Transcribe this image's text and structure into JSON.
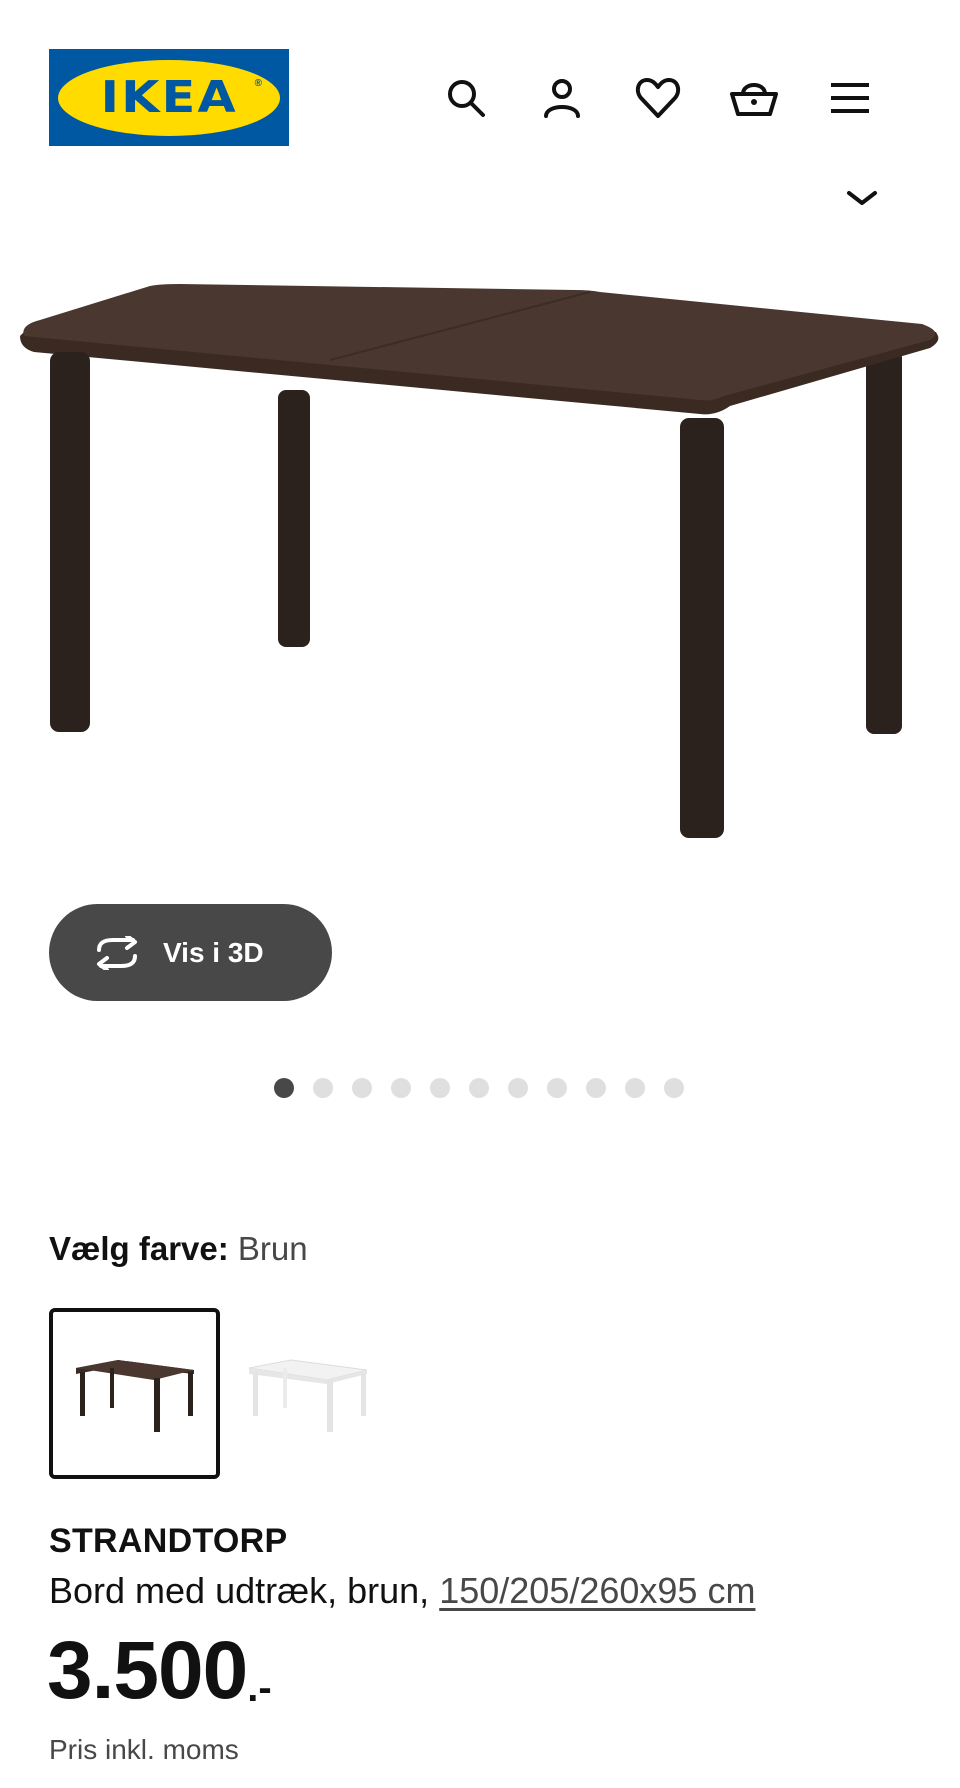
{
  "brand": {
    "logo_text": "IKEA",
    "logo_mark": "®",
    "colors": {
      "blue": "#0058a3",
      "yellow": "#ffdb00"
    }
  },
  "header": {
    "icons": [
      "search-icon",
      "user-icon",
      "heart-icon",
      "basket-icon",
      "menu-icon"
    ]
  },
  "gallery": {
    "view_3d_label": "Vis i 3D",
    "dot_count": 11,
    "active_dot": 1
  },
  "color": {
    "label": "Vælg farve:",
    "value": "Brun",
    "options": [
      "brown",
      "white"
    ],
    "selected": "brown"
  },
  "product": {
    "name": "STRANDTORP",
    "description": "Bord med udtræk, brun,",
    "dimensions_link": "150/205/260x95 cm",
    "price": "3.500",
    "price_suffix": ".-",
    "vat_note": "Pris inkl. moms"
  }
}
